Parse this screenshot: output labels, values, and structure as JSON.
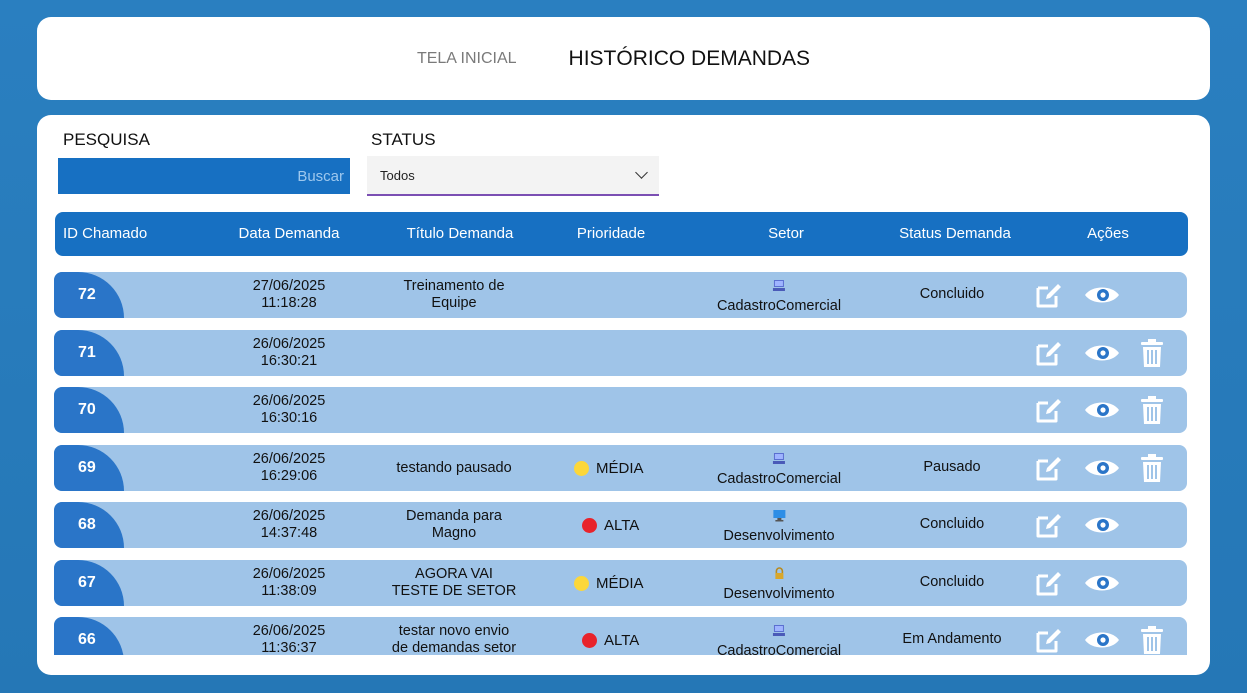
{
  "nav": {
    "home": "TELA INICIAL",
    "title": "HISTÓRICO DEMANDAS"
  },
  "filters": {
    "pesquisa_label": "PESQUISA",
    "search_button": "Buscar",
    "status_label": "STATUS",
    "status_value": "Todos"
  },
  "table": {
    "headers": [
      "ID Chamado",
      "Data Demanda",
      "Título Demanda",
      "Prioridade",
      "Setor",
      "Status Demanda",
      "Ações"
    ],
    "rows": [
      {
        "id": "72",
        "date": "27/06/2025",
        "time": "11:18:28",
        "title1": "Treinamento de",
        "title2": "Equipe",
        "priority": "",
        "priority_color": "",
        "setor": "CadastroComercial",
        "setor_icon": "computer-icon",
        "status": "Concluido",
        "delete": false
      },
      {
        "id": "71",
        "date": "26/06/2025",
        "time": "16:30:21",
        "title1": "",
        "title2": "",
        "priority": "",
        "priority_color": "",
        "setor": "",
        "setor_icon": "",
        "status": "",
        "delete": true
      },
      {
        "id": "70",
        "date": "26/06/2025",
        "time": "16:30:16",
        "title1": "",
        "title2": "",
        "priority": "",
        "priority_color": "",
        "setor": "",
        "setor_icon": "",
        "status": "",
        "delete": true
      },
      {
        "id": "69",
        "date": "26/06/2025",
        "time": "16:29:06",
        "title1": "testando pausado",
        "title2": "",
        "priority": "MÉDIA",
        "priority_color": "#fcd73a",
        "setor": "CadastroComercial",
        "setor_icon": "computer-icon",
        "status": "Pausado",
        "delete": true
      },
      {
        "id": "68",
        "date": "26/06/2025",
        "time": "14:37:48",
        "title1": "Demanda para",
        "title2": "Magno",
        "priority": "ALTA",
        "priority_color": "#e8232b",
        "setor": "Desenvolvimento",
        "setor_icon": "monitor-icon",
        "status": "Concluido",
        "delete": false
      },
      {
        "id": "67",
        "date": "26/06/2025",
        "time": "11:38:09",
        "title1": "AGORA VAI",
        "title2": "TESTE DE SETOR",
        "priority": "MÉDIA",
        "priority_color": "#fcd73a",
        "setor": "Desenvolvimento",
        "setor_icon": "lock-icon",
        "status": "Concluido",
        "delete": false
      },
      {
        "id": "66",
        "date": "26/06/2025",
        "time": "11:36:37",
        "title1": "testar novo envio",
        "title2": "de demandas setor",
        "priority": "ALTA",
        "priority_color": "#e8232b",
        "setor": "CadastroComercial",
        "setor_icon": "computer-icon",
        "status": "Em Andamento",
        "delete": true
      }
    ]
  },
  "colors": {
    "background": "#2a7fc0",
    "accent": "#1770c2",
    "row_bg": "#9fc4e8",
    "id_tab": "#2a75c8"
  }
}
